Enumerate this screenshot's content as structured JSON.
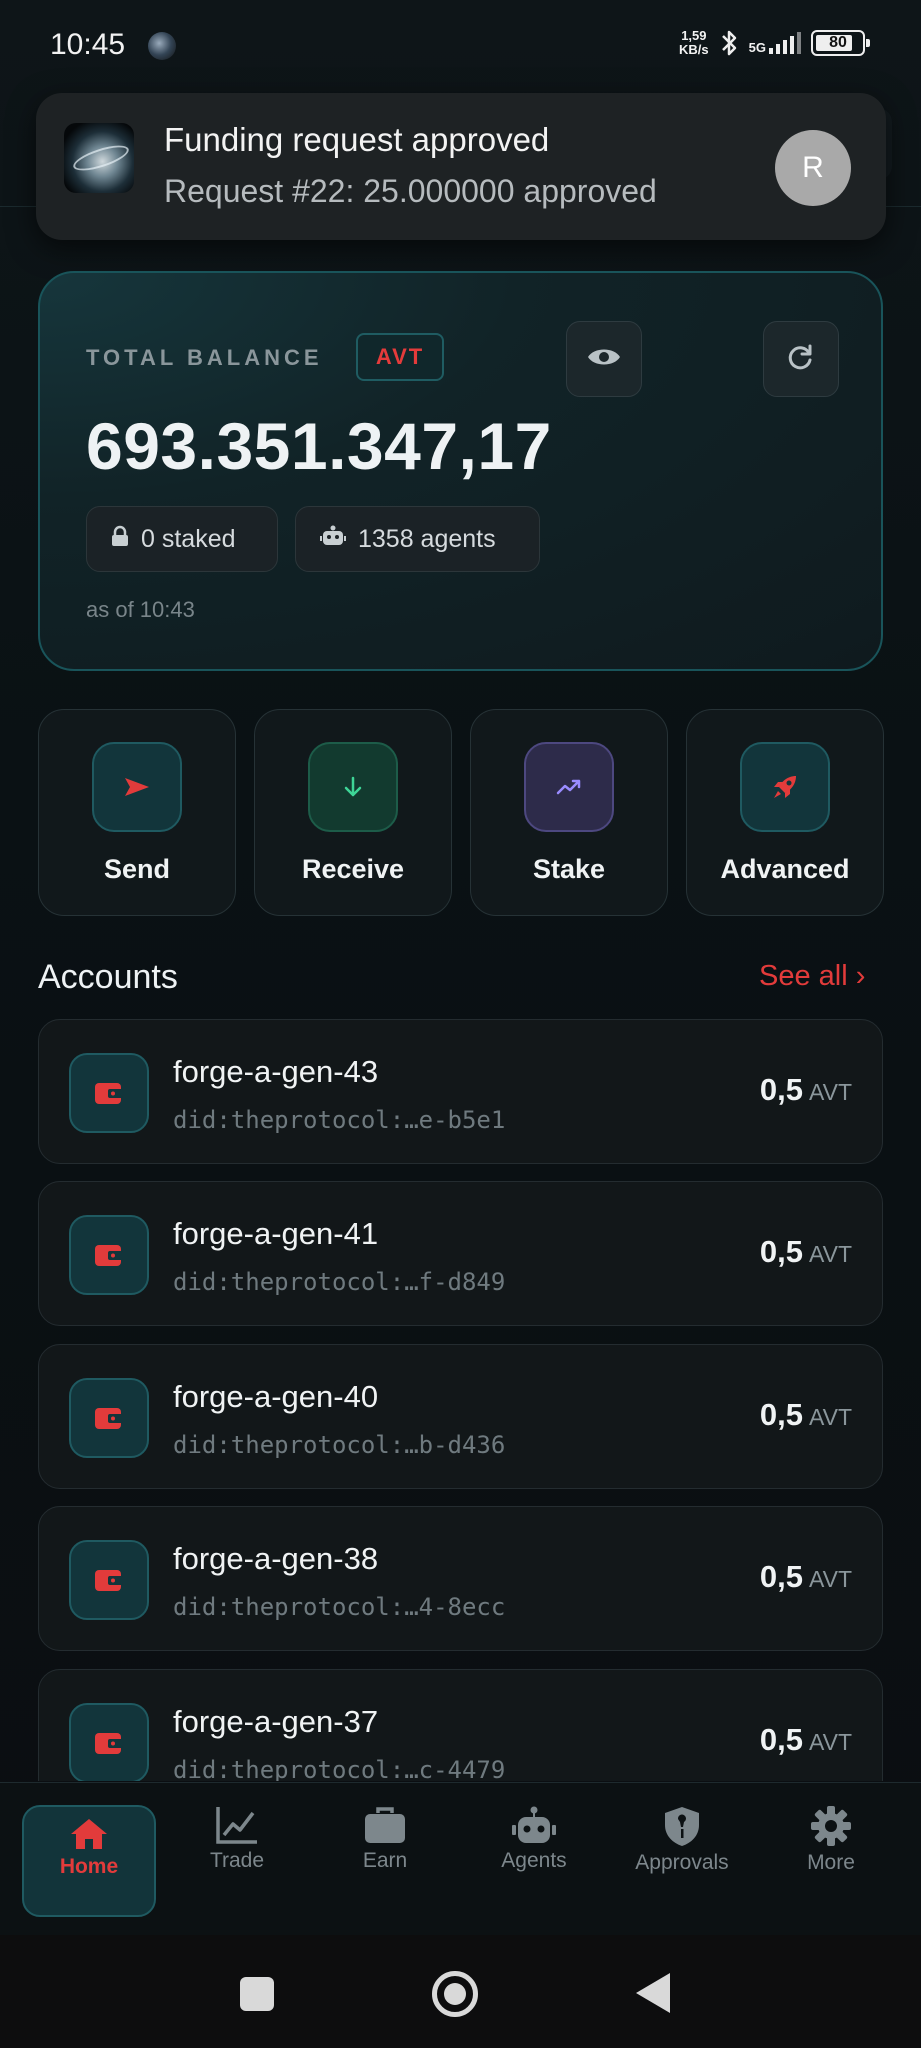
{
  "status_bar": {
    "time": "10:45",
    "net_speed_value": "1,59",
    "net_speed_unit": "KB/s",
    "network": "5G",
    "battery": "80"
  },
  "notification": {
    "title": "Funding request approved",
    "body": "Request #22: 25.000000 approved",
    "avatar_letter": "R"
  },
  "balance": {
    "label": "TOTAL BALANCE",
    "currency": "AVT",
    "amount": "693.351.347,17",
    "staked": "0 staked",
    "agents": "1358 agents",
    "as_of": "as of 10:43"
  },
  "actions": [
    {
      "label": "Send",
      "icon": "send-icon",
      "color": "#e23b3b"
    },
    {
      "label": "Receive",
      "icon": "arrow-down-icon",
      "color": "#3ed597"
    },
    {
      "label": "Stake",
      "icon": "trending-up-icon",
      "color": "#9a8cff"
    },
    {
      "label": "Advanced",
      "icon": "rocket-icon",
      "color": "#e23b3b"
    }
  ],
  "accounts": {
    "title": "Accounts",
    "see_all": "See all ›",
    "items": [
      {
        "name": "forge-a-gen-43",
        "did": "did:theprotocol:…e-b5e1",
        "amount": "0,5",
        "unit": "AVT"
      },
      {
        "name": "forge-a-gen-41",
        "did": "did:theprotocol:…f-d849",
        "amount": "0,5",
        "unit": "AVT"
      },
      {
        "name": "forge-a-gen-40",
        "did": "did:theprotocol:…b-d436",
        "amount": "0,5",
        "unit": "AVT"
      },
      {
        "name": "forge-a-gen-38",
        "did": "did:theprotocol:…4-8ecc",
        "amount": "0,5",
        "unit": "AVT"
      },
      {
        "name": "forge-a-gen-37",
        "did": "did:theprotocol:…c-4479",
        "amount": "0,5",
        "unit": "AVT"
      }
    ]
  },
  "nav": [
    {
      "label": "Home",
      "icon": "home-icon",
      "active": true
    },
    {
      "label": "Trade",
      "icon": "chart-icon"
    },
    {
      "label": "Earn",
      "icon": "briefcase-icon"
    },
    {
      "label": "Agents",
      "icon": "robot-icon"
    },
    {
      "label": "Approvals",
      "icon": "shield-icon"
    },
    {
      "label": "More",
      "icon": "gear-icon"
    }
  ],
  "colors": {
    "accent": "#e23b3b",
    "teal_border": "#1f5a61",
    "background": "#0b0f12"
  }
}
